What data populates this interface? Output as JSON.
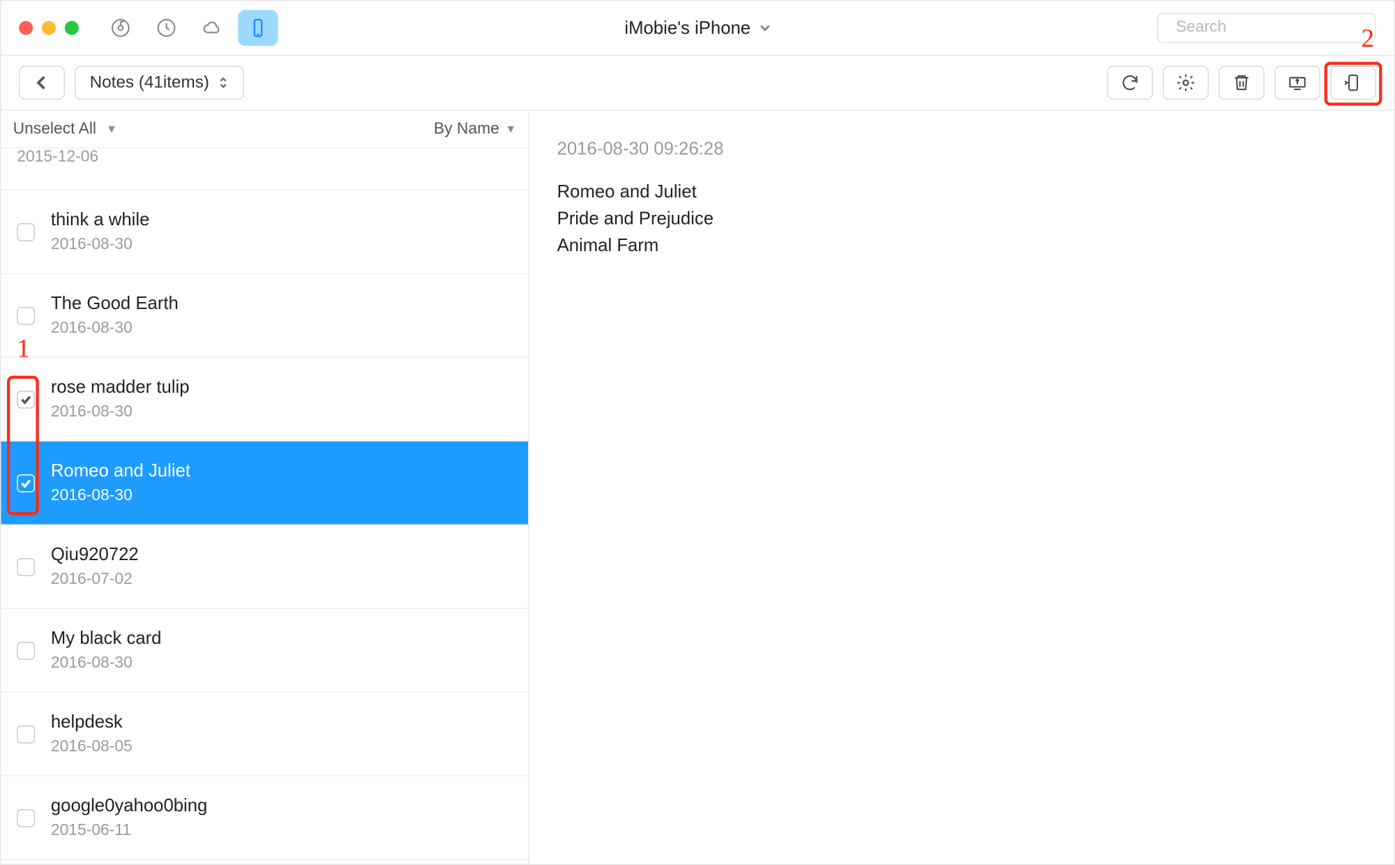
{
  "header": {
    "device_title": "iMobie's iPhone",
    "search_placeholder": "Search"
  },
  "toolbar": {
    "breadcrumb_label": "Notes (41items)"
  },
  "sidebar": {
    "select_label": "Unselect All",
    "sort_label": "By Name",
    "items": [
      {
        "title": "",
        "date": "2015-12-06",
        "checked": false,
        "partial": true
      },
      {
        "title": "think a while",
        "date": "2016-08-30",
        "checked": false
      },
      {
        "title": "The Good Earth",
        "date": "2016-08-30",
        "checked": false
      },
      {
        "title": "rose madder tulip",
        "date": "2016-08-30",
        "checked": true
      },
      {
        "title": "Romeo and Juliet",
        "date": "2016-08-30",
        "checked": true,
        "selected": true
      },
      {
        "title": "Qiu920722",
        "date": "2016-07-02",
        "checked": false
      },
      {
        "title": "My black card",
        "date": "2016-08-30",
        "checked": false
      },
      {
        "title": "helpdesk",
        "date": "2016-08-05",
        "checked": false
      },
      {
        "title": "google0yahoo0bing",
        "date": "2015-06-11",
        "checked": false
      }
    ]
  },
  "preview": {
    "timestamp": "2016-08-30 09:26:28",
    "lines": [
      "Romeo and Juliet",
      "Pride and Prejudice",
      "Animal Farm"
    ]
  },
  "annotations": {
    "label1": "1",
    "label2": "2"
  }
}
